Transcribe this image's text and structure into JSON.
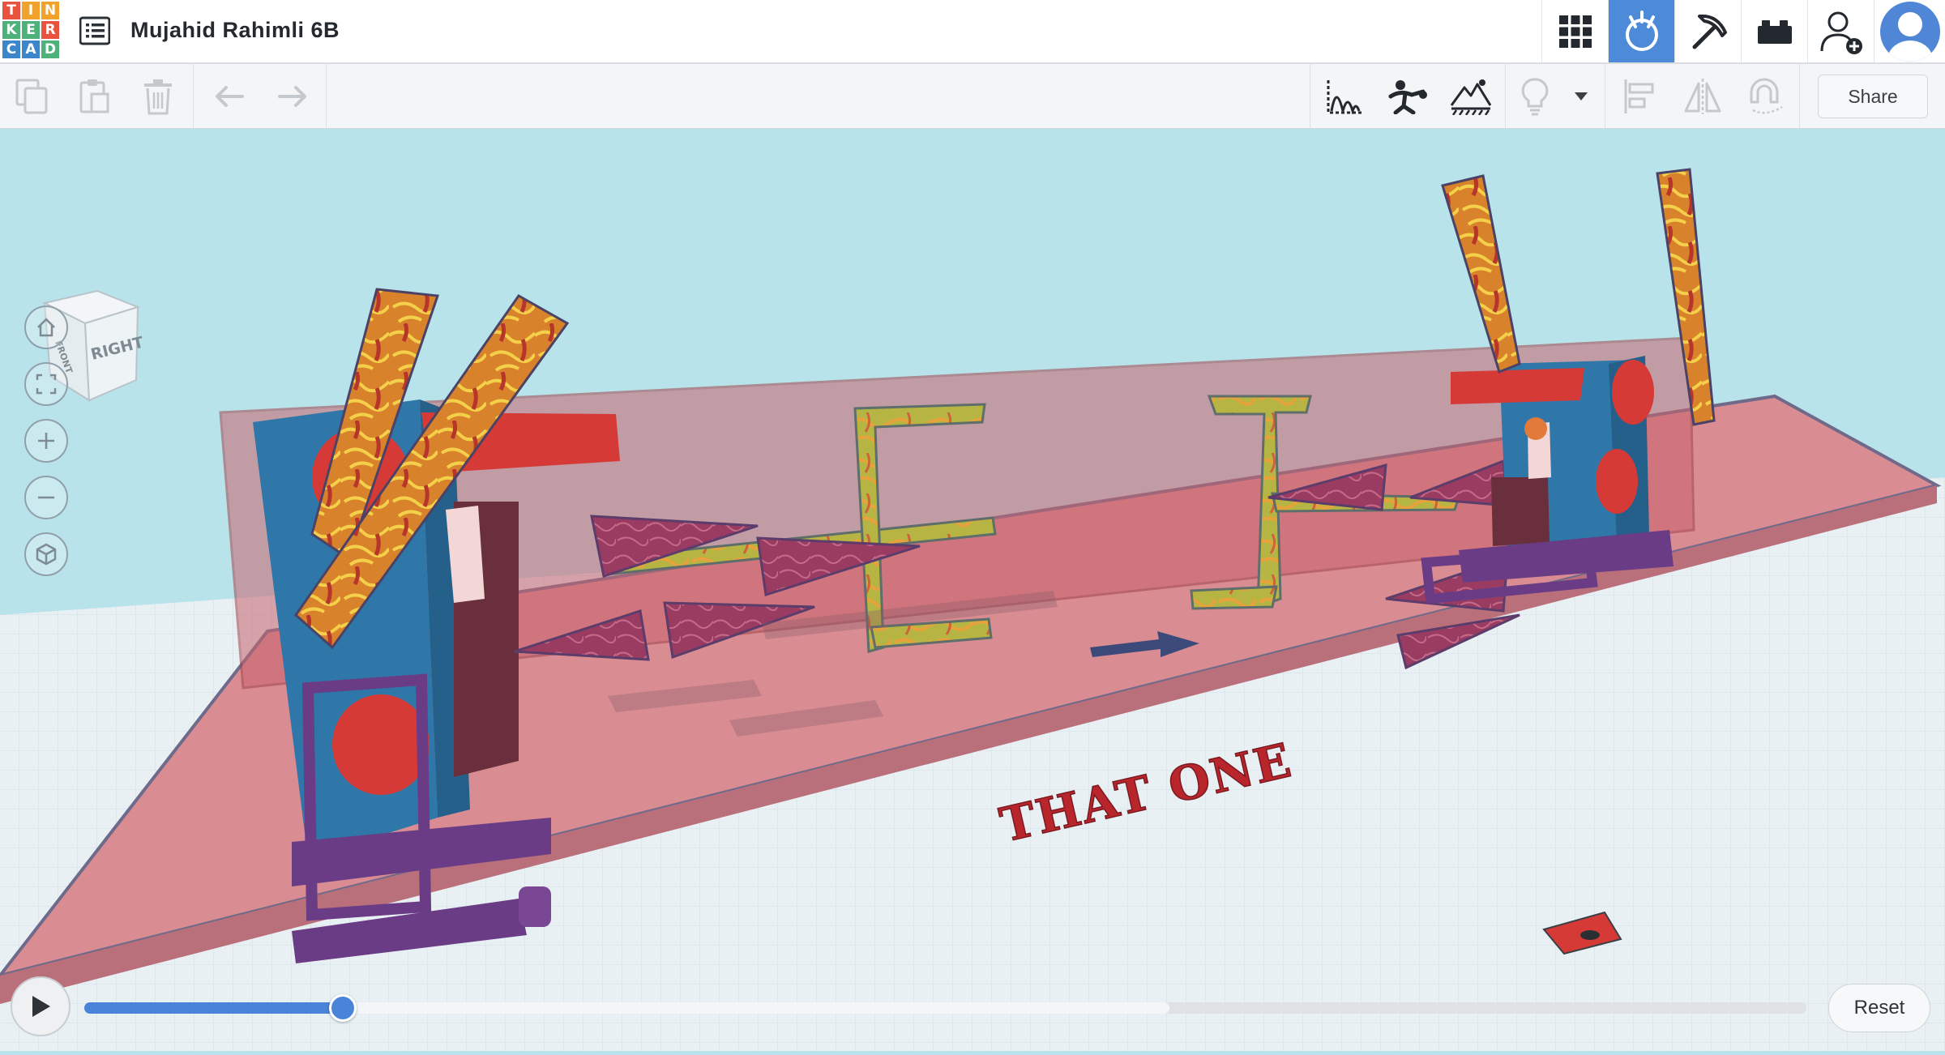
{
  "app": {
    "logo_letters": [
      "T",
      "I",
      "N",
      "K",
      "E",
      "R",
      "C",
      "A",
      "D"
    ],
    "logo_colors": [
      "#e8523f",
      "#f1a22a",
      "#f1a22a",
      "#4fb17a",
      "#4fb17a",
      "#e8523f",
      "#3c86c9",
      "#3c86c9",
      "#4fb17a"
    ],
    "design_title": "Mujahid Rahimli 6B"
  },
  "topnav": {
    "icons": [
      "grid-view-icon",
      "simulate-icon",
      "pickaxe-icon",
      "brick-icon",
      "invite-user-icon"
    ],
    "active": "simulate-icon",
    "accent": "#4d8ad8"
  },
  "toolbar": {
    "left_icons": [
      "copy-icon",
      "paste-icon",
      "delete-icon",
      "undo-icon",
      "redo-icon"
    ],
    "sim_icons": [
      "bounce-icon",
      "figure-icon",
      "terrain-icon",
      "lightbulb-icon",
      "dropdown-caret-icon"
    ],
    "align_icons": [
      "align-icon",
      "mirror-icon",
      "magnet-icon"
    ],
    "share_label": "Share"
  },
  "scene": {
    "viewcube_face": "RIGHT",
    "viewcube_side": "FRONT",
    "scene_text": "THAT ONE",
    "colors": {
      "sky": "#b9e3ea",
      "workplane": "#e8f0f4",
      "platform": "#d98d93",
      "lava": "#e2a22c",
      "cones": "#9a3b61",
      "machine_blue": "#2e77a8",
      "machine_red": "#d63a36",
      "frame_purple": "#6a3c86"
    }
  },
  "view_controls": [
    "home-view-icon",
    "fit-view-icon",
    "zoom-in-icon",
    "zoom-out-icon",
    "perspective-icon"
  ],
  "playback": {
    "progress": 0.15,
    "buffered": 0.63,
    "reset_label": "Reset"
  }
}
